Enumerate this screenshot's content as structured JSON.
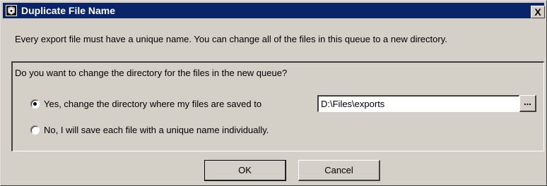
{
  "window": {
    "title": "Duplicate File Name",
    "close_label": "X",
    "icon": "app-icon"
  },
  "intro_text": "Every export file must have a unique name. You can change all of the files in this queue to a new directory.",
  "group": {
    "question": "Do you want to change the directory for the files in the new queue?",
    "options": [
      {
        "label": "Yes, change the directory where my files are saved to",
        "selected": true
      },
      {
        "label": "No, I will save each file with a unique name individually.",
        "selected": false
      }
    ],
    "directory": {
      "value": "D:\\Files\\exports",
      "browse_label": "..."
    }
  },
  "buttons": {
    "ok_label": "OK",
    "cancel_label": "Cancel"
  },
  "colors": {
    "titlebar": "#0a246a",
    "face": "#d4d0c8"
  }
}
